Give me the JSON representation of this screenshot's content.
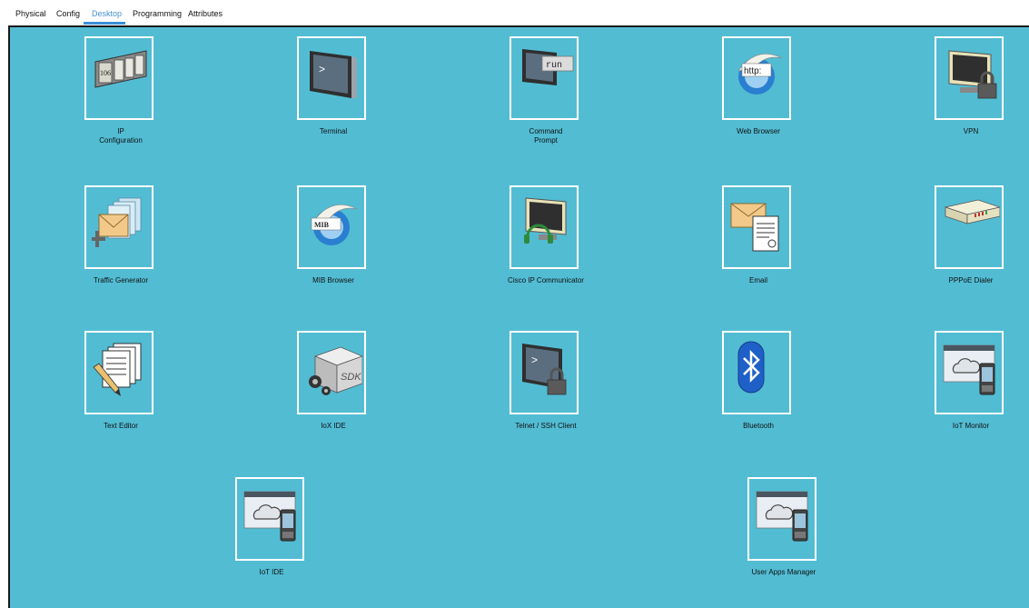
{
  "tabs": [
    {
      "label": "Physical",
      "active": false
    },
    {
      "label": "Config",
      "active": false
    },
    {
      "label": "Desktop",
      "active": true
    },
    {
      "label": "Programming",
      "active": false
    },
    {
      "label": "Attributes",
      "active": false
    }
  ],
  "desktop": {
    "background": "#52bcd3",
    "apps": [
      {
        "label": "IP\nConfiguration",
        "icon": "ip-configuration-icon",
        "icon_text": "106"
      },
      {
        "label": "Terminal",
        "icon": "terminal-icon",
        "icon_text": ">"
      },
      {
        "label": "Command\nPrompt",
        "icon": "command-prompt-icon",
        "icon_text": "run"
      },
      {
        "label": "Web Browser",
        "icon": "web-browser-icon",
        "icon_text": "http:"
      },
      {
        "label": "VPN",
        "icon": "vpn-icon"
      },
      {
        "label": "Traffic Generator",
        "icon": "traffic-generator-icon"
      },
      {
        "label": "MIB Browser",
        "icon": "mib-browser-icon",
        "icon_text": "MIB"
      },
      {
        "label": "Cisco IP Communicator",
        "icon": "cisco-ip-communicator-icon"
      },
      {
        "label": "Email",
        "icon": "email-icon"
      },
      {
        "label": "PPPoE Dialer",
        "icon": "pppoe-dialer-icon"
      },
      {
        "label": "Text Editor",
        "icon": "text-editor-icon"
      },
      {
        "label": "IoX IDE",
        "icon": "iox-ide-icon",
        "icon_text": "SDK"
      },
      {
        "label": "Telnet / SSH Client",
        "icon": "telnet-ssh-client-icon",
        "icon_text": ">"
      },
      {
        "label": "Bluetooth",
        "icon": "bluetooth-icon"
      },
      {
        "label": "IoT Monitor",
        "icon": "iot-monitor-icon"
      },
      {
        "label": "IoT IDE",
        "icon": "iot-ide-icon"
      },
      {
        "label": "User Apps Manager",
        "icon": "user-apps-manager-icon"
      }
    ]
  }
}
